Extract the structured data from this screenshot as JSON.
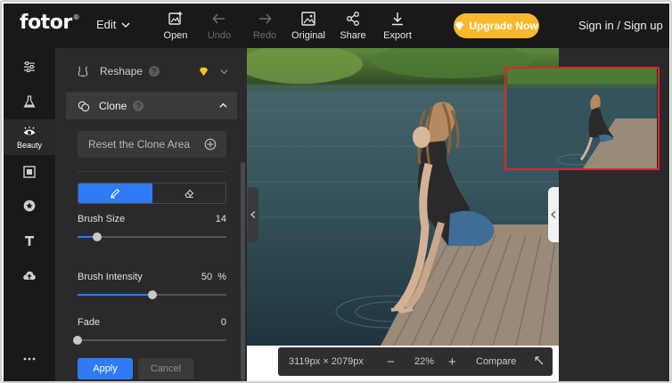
{
  "app": {
    "logo": "fotor",
    "logo_mark": "®",
    "edit_menu": "Edit"
  },
  "toolbar": [
    {
      "label": "Open",
      "icon": "image-upload-icon",
      "enabled": true
    },
    {
      "label": "Undo",
      "icon": "arrow-left-icon",
      "enabled": false
    },
    {
      "label": "Redo",
      "icon": "arrow-right-icon",
      "enabled": false
    },
    {
      "label": "Original",
      "icon": "image-icon",
      "enabled": true
    },
    {
      "label": "Share",
      "icon": "share-icon",
      "enabled": true
    },
    {
      "label": "Export",
      "icon": "download-icon",
      "enabled": true
    }
  ],
  "header": {
    "upgrade_label": "Upgrade Now",
    "sign_in": "Sign in",
    "separator": "/",
    "sign_up": "Sign up"
  },
  "rail": {
    "items": [
      {
        "icon": "sliders-icon",
        "label": ""
      },
      {
        "icon": "flask-icon",
        "label": ""
      },
      {
        "icon": "eye-icon",
        "label": "Beauty",
        "active": true
      },
      {
        "icon": "frame-icon",
        "label": ""
      },
      {
        "icon": "star-badge-icon",
        "label": ""
      },
      {
        "icon": "text-icon",
        "label": ""
      },
      {
        "icon": "cloud-upload-icon",
        "label": ""
      },
      {
        "icon": "more-icon",
        "label": ""
      }
    ]
  },
  "panel": {
    "reshape_label": "Reshape",
    "help_glyph": "?",
    "clone_label": "Clone",
    "reset_label": "Reset the Clone Area",
    "brush_size": {
      "label": "Brush Size",
      "value": "14",
      "level": 0.13
    },
    "brush_intensity": {
      "label": "Brush Intensity",
      "value": "50",
      "unit": "%",
      "level": 0.5
    },
    "fade": {
      "label": "Fade",
      "value": "0",
      "level": 0.0
    },
    "apply_label": "Apply",
    "cancel_label": "Cancel"
  },
  "zoom": {
    "dimensions": "3119px × 2079px",
    "minus": "−",
    "percent": "22%",
    "plus": "+",
    "compare": "Compare"
  },
  "colors": {
    "accent": "#2f7bf6",
    "upgrade": "#f7b92b",
    "minimap_border": "#e0242b",
    "premium_gem": "#f5c518"
  }
}
